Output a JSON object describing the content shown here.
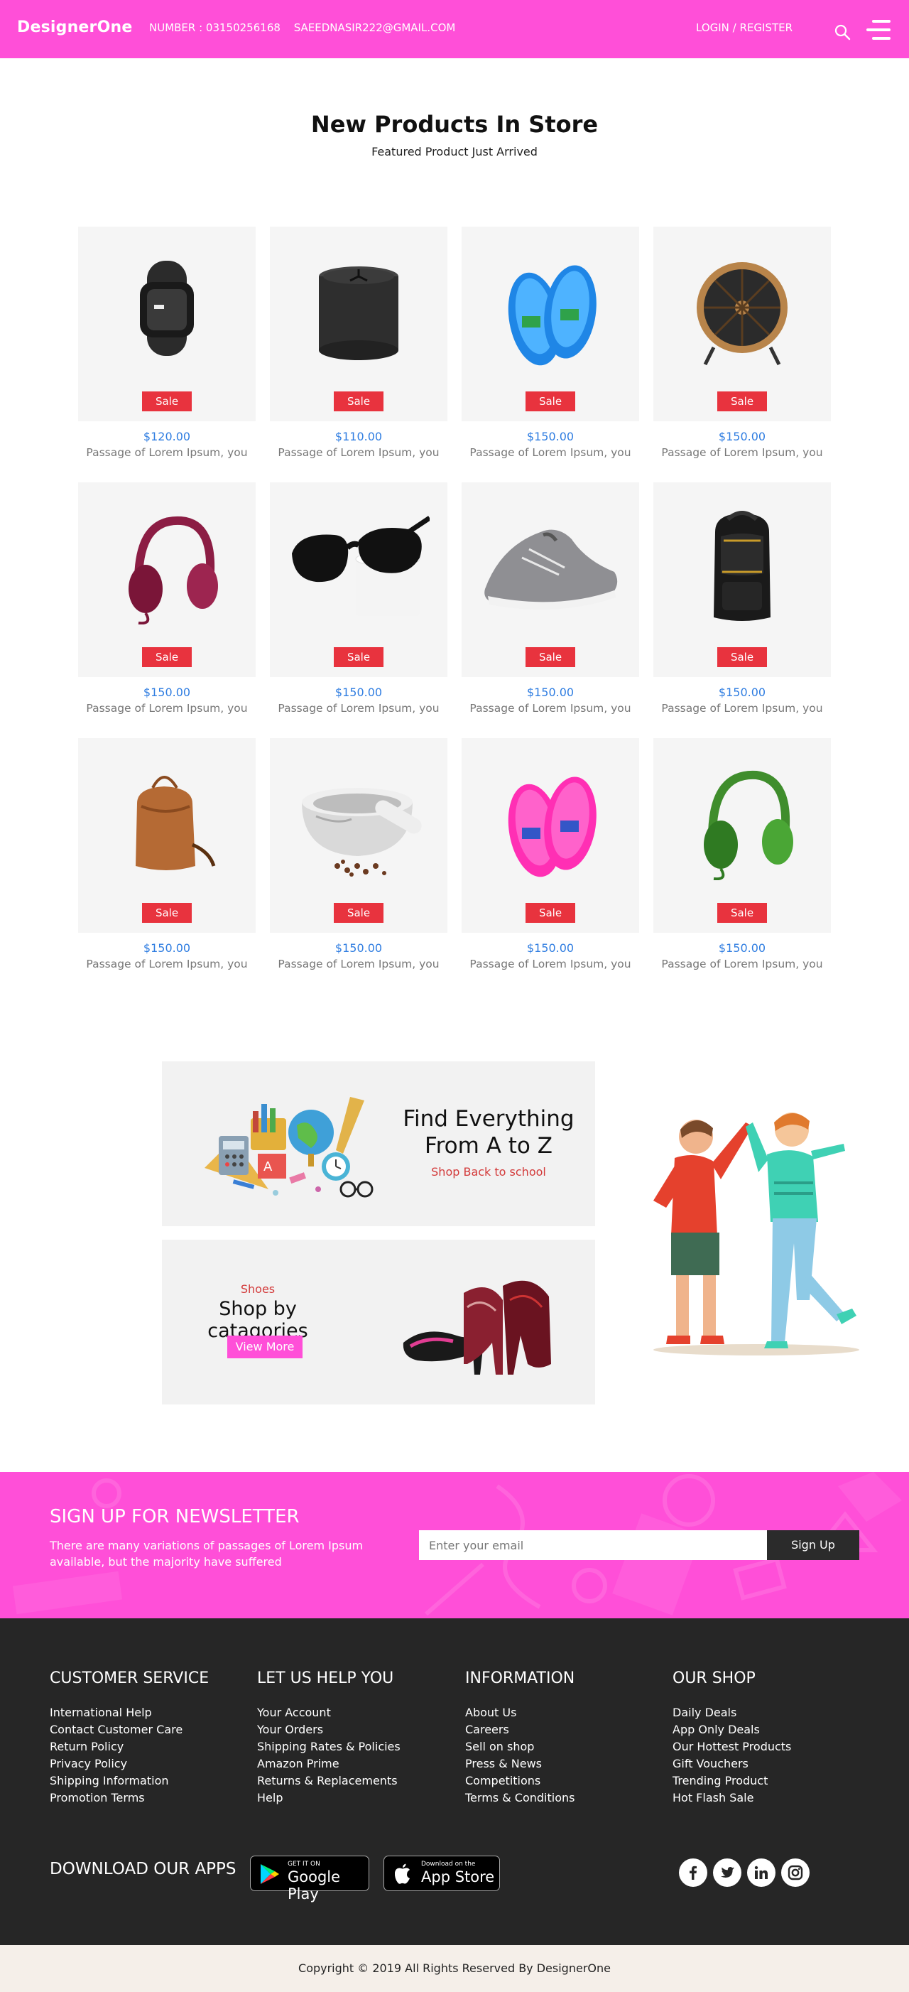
{
  "header": {
    "logo": "DesignerOne",
    "number": "NUMBER : 03150256168",
    "email": "SAEEDNASIR222@GMAIL.COM",
    "login": "LOGIN / REGISTER"
  },
  "products_section": {
    "title": "New Products In Store",
    "subtitle": "Featured Product Just Arrived"
  },
  "products": [
    {
      "art": "fitness-band",
      "sale": "Sale",
      "price": "$120.00",
      "desc": "Passage of Lorem Ipsum, you"
    },
    {
      "art": "speaker",
      "sale": "Sale",
      "price": "$110.00",
      "desc": "Passage of Lorem Ipsum, you"
    },
    {
      "art": "blue-slippers",
      "sale": "Sale",
      "price": "$150.00",
      "desc": "Passage of Lorem Ipsum, you"
    },
    {
      "art": "fan",
      "sale": "Sale",
      "price": "$150.00",
      "desc": "Passage of Lorem Ipsum, you"
    },
    {
      "art": "red-headphones",
      "sale": "Sale",
      "price": "$150.00",
      "desc": "Passage of Lorem Ipsum, you"
    },
    {
      "art": "sunglasses",
      "sale": "Sale",
      "price": "$150.00",
      "desc": "Passage of Lorem Ipsum, you"
    },
    {
      "art": "sneaker",
      "sale": "Sale",
      "price": "$150.00",
      "desc": "Passage of Lorem Ipsum, you"
    },
    {
      "art": "backpack",
      "sale": "Sale",
      "price": "$150.00",
      "desc": "Passage of Lorem Ipsum, you"
    },
    {
      "art": "leather-bag",
      "sale": "Sale",
      "price": "$150.00",
      "desc": "Passage of Lorem Ipsum, you"
    },
    {
      "art": "mortar",
      "sale": "Sale",
      "price": "$150.00",
      "desc": "Passage of Lorem Ipsum, you"
    },
    {
      "art": "pink-slippers",
      "sale": "Sale",
      "price": "$150.00",
      "desc": "Passage of Lorem Ipsum, you"
    },
    {
      "art": "green-headphones",
      "sale": "Sale",
      "price": "$150.00",
      "desc": "Passage of Lorem Ipsum, you"
    }
  ],
  "promo_school": {
    "title_line1": "Find Everything",
    "title_line2": "From A to Z",
    "link": "Shop Back to school"
  },
  "promo_shoes": {
    "kicker": "Shoes",
    "title": "Shop by catagories",
    "button": "View More"
  },
  "newsletter": {
    "title": "SIGN UP FOR NEWSLETTER",
    "text": "There are many variations of passages of Lorem Ipsum available, but the majority have suffered",
    "placeholder": "Enter your email",
    "button": "Sign Up"
  },
  "footer": {
    "columns": [
      {
        "title": "CUSTOMER SERVICE",
        "links": [
          "International Help",
          "Contact Customer Care",
          "Return Policy",
          "Privacy Policy",
          "Shipping Information",
          "Promotion Terms"
        ]
      },
      {
        "title": "LET US HELP YOU",
        "links": [
          "Your Account",
          "Your Orders",
          "Shipping Rates & Policies",
          "Amazon Prime",
          "Returns & Replacements",
          "Help"
        ]
      },
      {
        "title": "INFORMATION",
        "links": [
          "About Us",
          "Careers",
          "Sell on shop",
          "Press & News",
          "Competitions",
          "Terms & Conditions"
        ]
      },
      {
        "title": "OUR SHOP",
        "links": [
          "Daily Deals",
          "App Only Deals",
          "Our Hottest Products",
          "Gift Vouchers",
          "Trending Product",
          "Hot Flash Sale"
        ]
      }
    ],
    "apps_title": "DOWNLOAD OUR APPS",
    "google_play": {
      "small": "GET IT ON",
      "big": "Google Play"
    },
    "app_store": {
      "small": "Download on the",
      "big": "App Store"
    },
    "social": [
      "facebook-icon",
      "twitter-icon",
      "linkedin-icon",
      "instagram-icon"
    ]
  },
  "copyright": "Copyright © 2019 All Rights Reserved By DesignerOne",
  "colors": {
    "brand_pink": "#ff4fd8",
    "sale_red": "#e8333e",
    "price_blue": "#2f7de1",
    "footer_dark": "#262626"
  }
}
